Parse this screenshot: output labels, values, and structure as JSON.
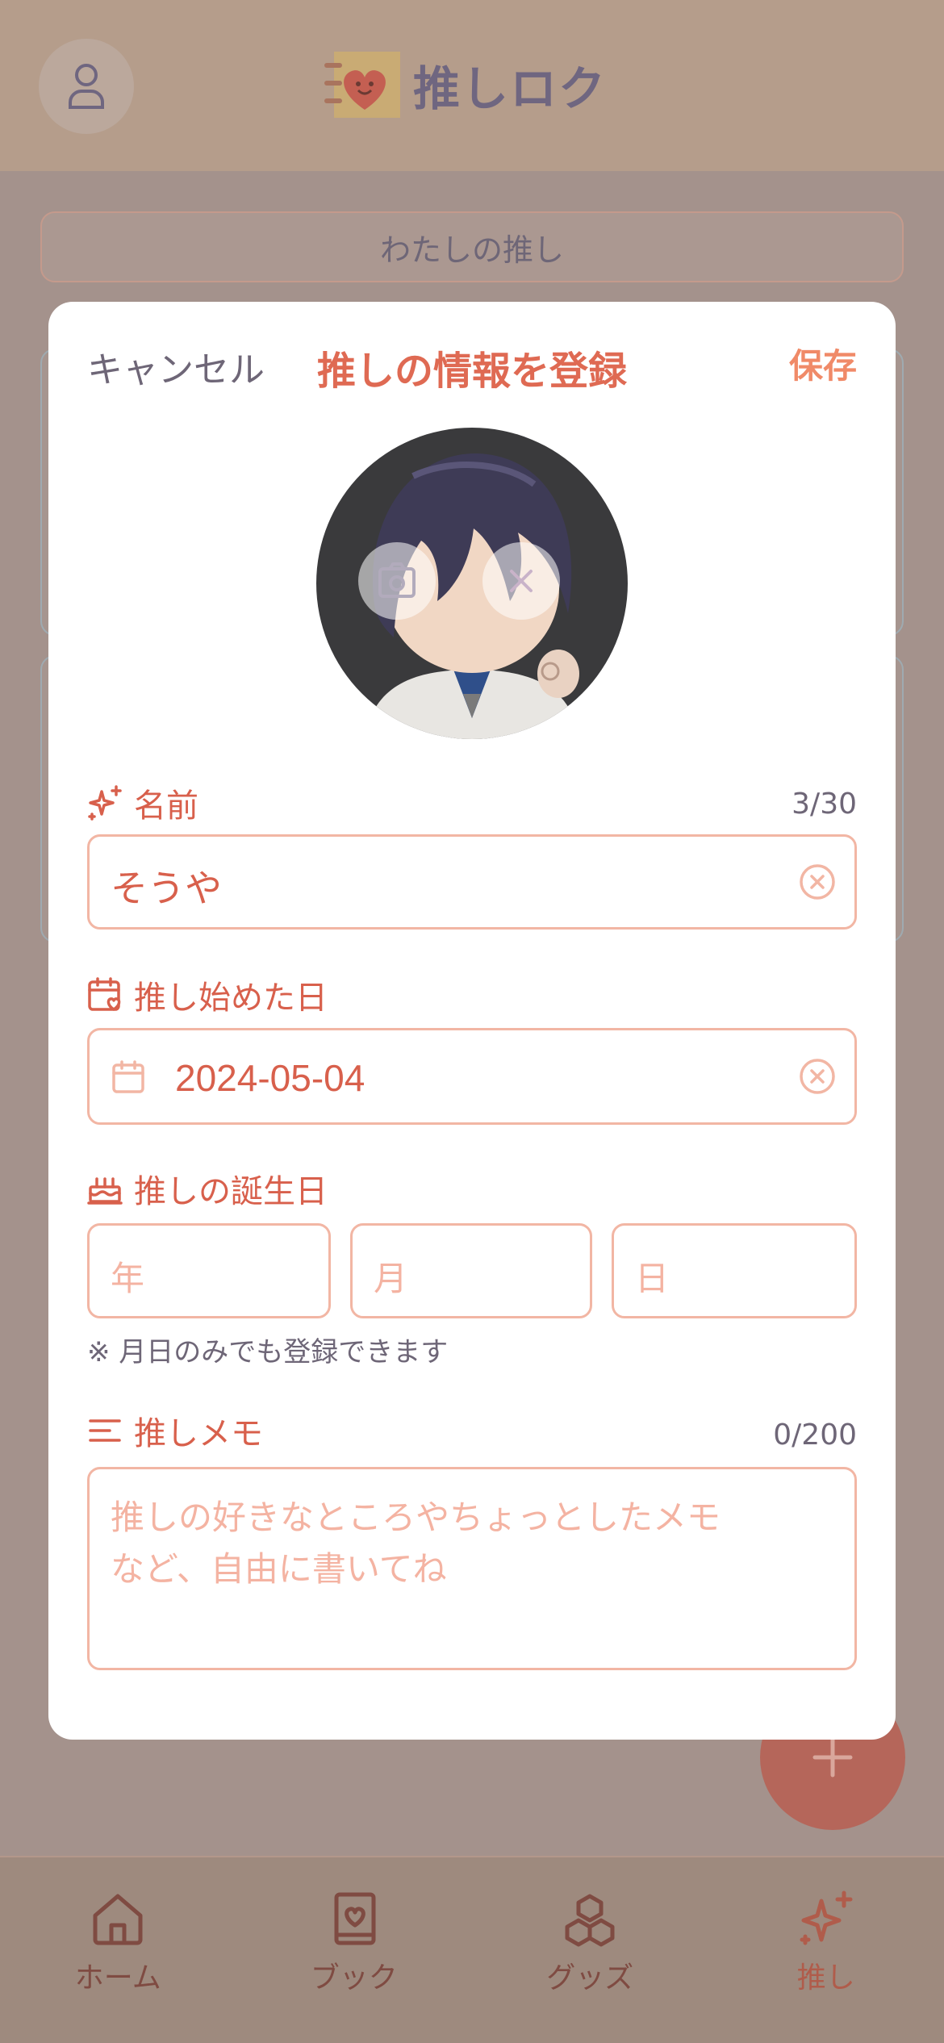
{
  "app": {
    "title": "推しロク",
    "my_oshi_tab": "わたしの推し"
  },
  "modal": {
    "cancel_label": "キャンセル",
    "title": "推しの情報を登録",
    "save_label": "保存",
    "name": {
      "label": "名前",
      "counter": "3/30",
      "value": "そうや"
    },
    "start_date": {
      "label": "推し始めた日",
      "value": "2024-05-04"
    },
    "birthday": {
      "label": "推しの誕生日",
      "year_placeholder": "年",
      "month_placeholder": "月",
      "day_placeholder": "日",
      "note": "※ 月日のみでも登録できます"
    },
    "memo": {
      "label": "推しメモ",
      "counter": "0/200",
      "placeholder_line1": "推しの好きなところやちょっとしたメモ",
      "placeholder_line2": "など、自由に書いてね"
    }
  },
  "tabbar": {
    "items": [
      {
        "label": "ホーム",
        "icon": "home-icon"
      },
      {
        "label": "ブック",
        "icon": "book-heart-icon"
      },
      {
        "label": "グッズ",
        "icon": "boxes-icon"
      },
      {
        "label": "推し",
        "icon": "sparkles-icon",
        "active": true
      }
    ]
  },
  "colors": {
    "accent": "#df6a53",
    "accent_light": "#f2b6a4",
    "text_muted": "#6e6677",
    "overlay_bg": "#a4928c"
  }
}
